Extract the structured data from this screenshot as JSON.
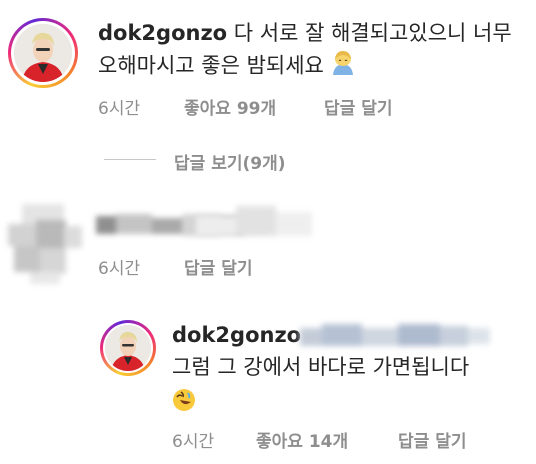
{
  "comments": [
    {
      "username": "dok2gonzo",
      "text_line1": "다 서로 잘 해결되고있으니 너무",
      "text_line2": "오해마시고 좋은 밤되세요",
      "emoji": "person-bowing-emoji",
      "time": "6시간",
      "likes_label": "좋아요 99개",
      "reply_label": "답글 달기"
    },
    {
      "view_replies_label": "답글 보기(9개)"
    },
    {
      "username": "",
      "time": "6시간",
      "reply_label": "답글 달기"
    },
    {
      "username": "dok2gonzo",
      "text_line1": "그럼 그 강에서 바다로 가면됩니다",
      "emoji": "rolling-on-floor-laughing-emoji",
      "time": "6시간",
      "likes_label": "좋아요 14개",
      "reply_label": "답글 달기"
    }
  ]
}
